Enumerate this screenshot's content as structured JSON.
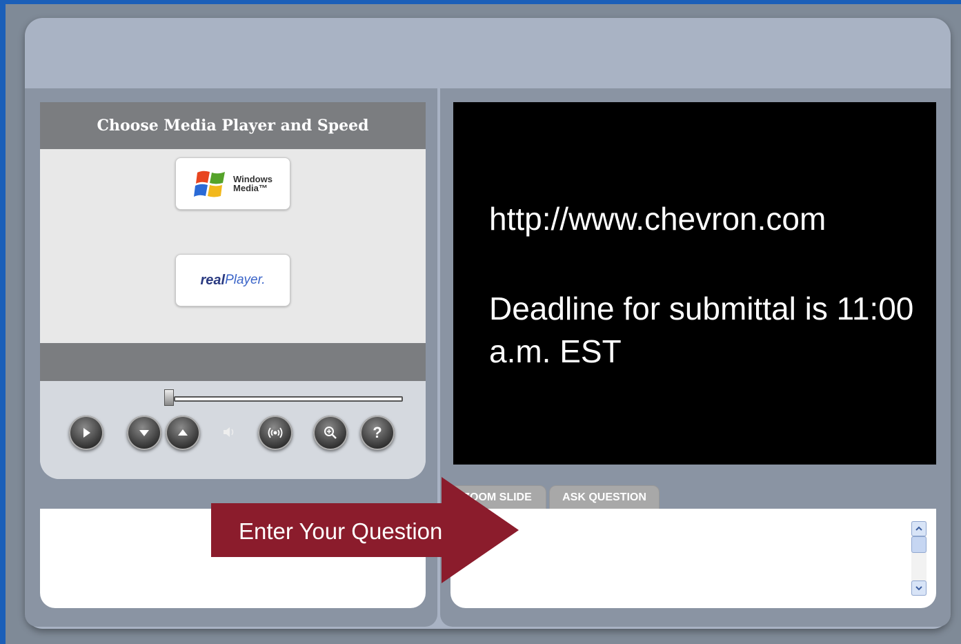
{
  "media_panel": {
    "title": "Choose Media Player and Speed",
    "windows_media": {
      "line1": "Windows",
      "line2": "Media™",
      "icon": "windows-flag-icon"
    },
    "real_player": {
      "brand_real": "real",
      "brand_player": "Player."
    }
  },
  "controls": {
    "play_icon": "play-icon",
    "volume_down_icon": "chevron-down-icon",
    "volume_up_icon": "chevron-up-icon",
    "speaker_icon": "speaker-icon",
    "broadcast_icon": "broadcast-icon",
    "zoom_icon": "zoom-icon",
    "help_label": "?"
  },
  "slide": {
    "url": "http://www.chevron.com",
    "deadline": "Deadline for submittal is 11:00 a.m. EST"
  },
  "tabs": [
    {
      "label": "ZOOM SLIDE"
    },
    {
      "label": "ASK QUESTION"
    }
  ],
  "callout": {
    "text": "Enter Your Question",
    "color": "#8b1c2c"
  }
}
